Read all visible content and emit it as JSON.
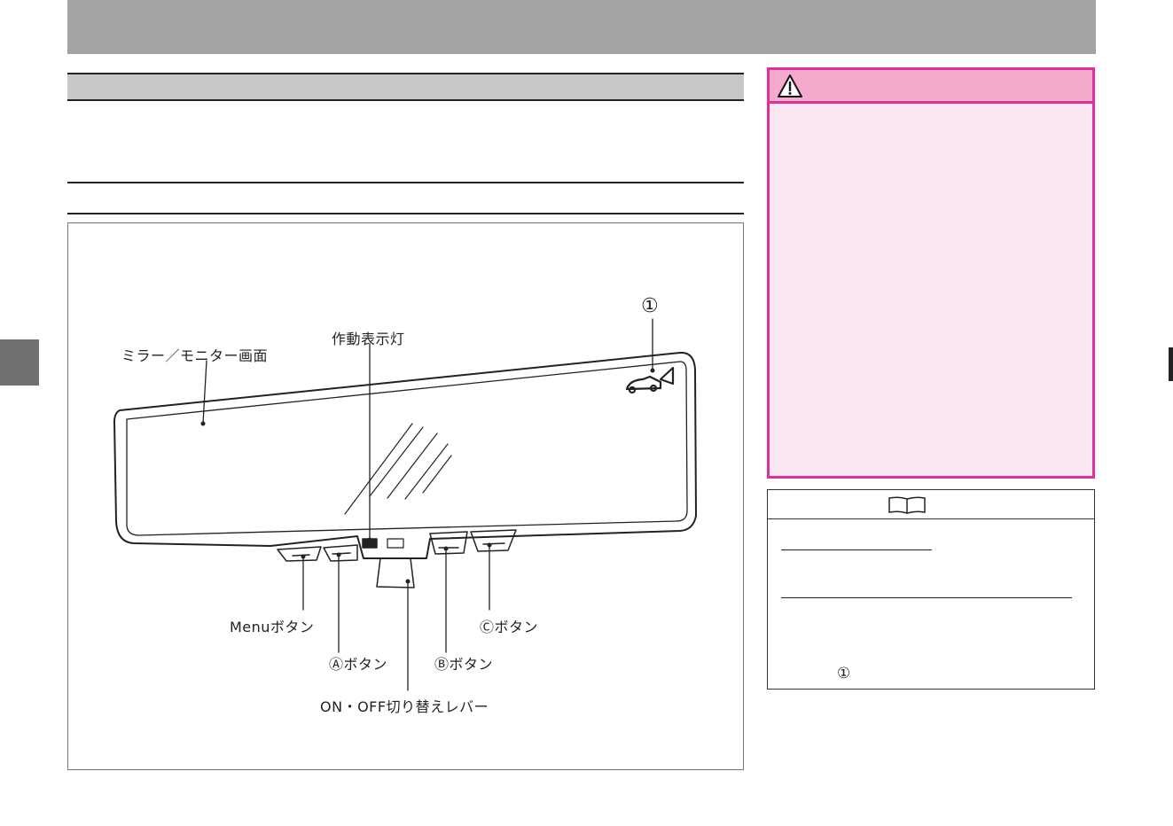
{
  "page": {
    "header_color": "#a2a3a5",
    "side_tab_color": "#6f7072"
  },
  "figure": {
    "labels": {
      "mirror_screen": "ミラー／モニター画面",
      "indicator_lamp": "作動表示灯",
      "callout_1": "①",
      "menu_button": "Menuボタン",
      "a_button": "Ⓐボタン",
      "b_button": "Ⓑボタン",
      "c_button": "Ⓒボタン",
      "on_off_lever": "ON・OFF切り替えレバー"
    },
    "icons": [
      "rear-car-camera-icon"
    ]
  },
  "warning": {
    "icon": "warning-triangle-icon",
    "accent_color": "#e0319a",
    "header_color": "#f4a9cd",
    "body_color": "#fae6f0"
  },
  "note": {
    "icon": "book-icon",
    "marker": "①"
  }
}
